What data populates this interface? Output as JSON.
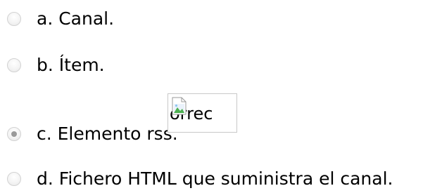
{
  "options": [
    {
      "label": "a. Canal.",
      "selected": false
    },
    {
      "label": "b. Ítem.",
      "selected": false
    },
    {
      "label": "c. Elemento rss.",
      "selected": true
    },
    {
      "label": "d. Fichero HTML que suministra el canal.",
      "selected": false
    }
  ],
  "feedback_image": {
    "alt": "Incorrecto",
    "visible_alt_fragment": "orrec",
    "icon": "broken-image-icon"
  }
}
